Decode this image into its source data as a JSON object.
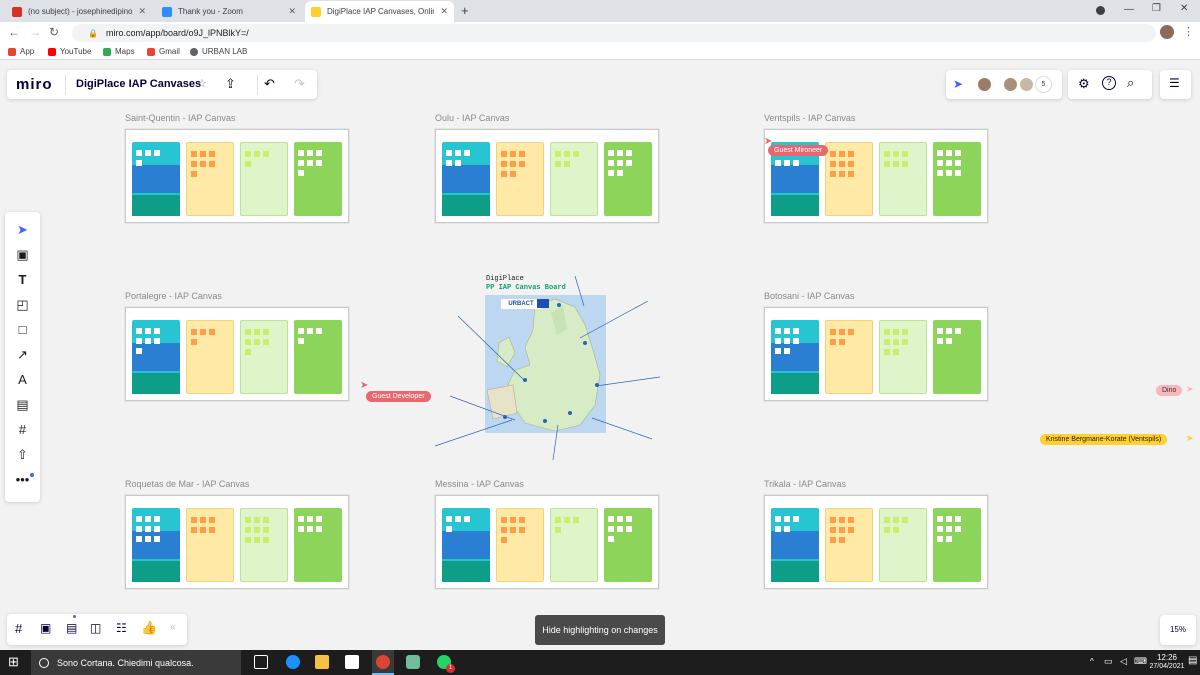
{
  "browser": {
    "tabs": [
      {
        "label": "(no subject) - josephinedipino@",
        "favicon_color": "#d93025"
      },
      {
        "label": "Thank you - Zoom",
        "favicon_color": "#2d8cff"
      },
      {
        "label": "DigiPlace IAP Canvases, Online W",
        "favicon_color": "#ffd02f"
      }
    ],
    "new_tab": "+",
    "url": "miro.com/app/board/o9J_lPNBlkY=/",
    "bookmarks": [
      {
        "label": "App",
        "color": "#ea4335"
      },
      {
        "label": "YouTube",
        "color": "#ff0000"
      },
      {
        "label": "Maps",
        "color": "#34a853"
      },
      {
        "label": "Gmail",
        "color": "#ea4335"
      },
      {
        "label": "URBAN LAB",
        "color": "#5f6368"
      }
    ]
  },
  "miro": {
    "logo": "miro",
    "board_name": "DigiPlace IAP Canvases",
    "participant_count": "5",
    "zoom": "15%",
    "highlight_button": "Hide highlighting on changes"
  },
  "canvases": [
    {
      "title": "Saint-Quentin - IAP Canvas"
    },
    {
      "title": "Oulu - IAP Canvas"
    },
    {
      "title": "Ventspils - IAP Canvas"
    },
    {
      "title": "Portalegre - IAP Canvas"
    },
    {
      "title": "Botosani - IAP Canvas"
    },
    {
      "title": "Roquetas de Mar - IAP Canvas"
    },
    {
      "title": "Messina - IAP Canvas"
    },
    {
      "title": "Trikala - IAP Canvas"
    }
  ],
  "center_board": {
    "title_line1": "DigiPlace",
    "title_line2": "PP IAP Canvas Board"
  },
  "cursors": {
    "guest_mironeer": "Guest Mironeer",
    "guest_developer": "Guest Developer",
    "dino": "Dino",
    "kristine": "Kristine Bergmane-Korate (Ventspils)"
  },
  "taskbar": {
    "search_placeholder": "Sono Cortana. Chiedimi qualcosa.",
    "time": "12:26",
    "date": "27/04/2021",
    "notification_badge": "1"
  }
}
